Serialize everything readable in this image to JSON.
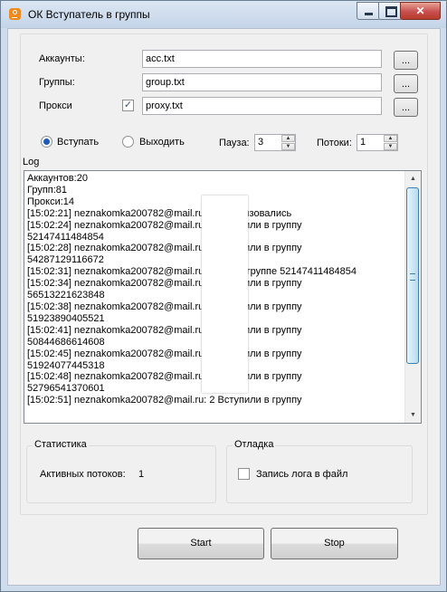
{
  "window": {
    "title": "ОК Вступатель в группы",
    "close_glyph": "✕"
  },
  "files": {
    "accounts": {
      "label": "Аккаунты:",
      "value": "acc.txt",
      "browse_label": "..."
    },
    "groups": {
      "label": "Группы:",
      "value": "group.txt",
      "browse_label": "..."
    },
    "proxy": {
      "label": "Прокси",
      "checked": true,
      "check_glyph": "✓",
      "value": "proxy.txt",
      "browse_label": "..."
    }
  },
  "mode": {
    "join_label": "Вступать",
    "leave_label": "Выходить",
    "selected": "join"
  },
  "pause": {
    "label": "Пауза:",
    "value": "3"
  },
  "threads": {
    "label": "Потоки:",
    "value": "1"
  },
  "log": {
    "title": "Log",
    "lines": [
      "Аккаунтов:20",
      "Групп:81",
      "Прокси:14",
      "[15:02:21] neznakomka200782@mail.ru:                2 авторизовались",
      "[15:02:24] neznakomka200782@mail.ru:                2 Вступили в группу",
      "52147411484854",
      "[15:02:28] neznakomka200782@mail.ru:                2 Вступили в группу",
      "54287129116672",
      "[15:02:31] neznakomka200782@mail.ru:                2 Уже в группе 52147411484854",
      "[15:02:34] neznakomka200782@mail.ru:                2 Вступили в группу",
      "56513221623848",
      "[15:02:38] neznakomka200782@mail.ru:                2 Вступили в группу",
      "51923890405521",
      "[15:02:41] neznakomka200782@mail.ru:                2 Вступили в группу",
      "50844686614608",
      "[15:02:45] neznakomka200782@mail.ru:                2 Вступили в группу",
      "51924077445318",
      "[15:02:48] neznakomka200782@mail.ru:                2 Вступили в группу",
      "52796541370601",
      "[15:02:51] neznakomka200782@mail.ru:                2 Вступили в группу"
    ],
    "scroll_up_glyph": "▲",
    "scroll_down_glyph": "▼"
  },
  "stats": {
    "title": "Статистика",
    "active_label": "Активных потоков:",
    "active_value": "1"
  },
  "debug": {
    "title": "Отладка",
    "log_to_file_label": "Запись лога в файл",
    "log_to_file_checked": false
  },
  "buttons": {
    "start": "Start",
    "stop": "Stop"
  }
}
